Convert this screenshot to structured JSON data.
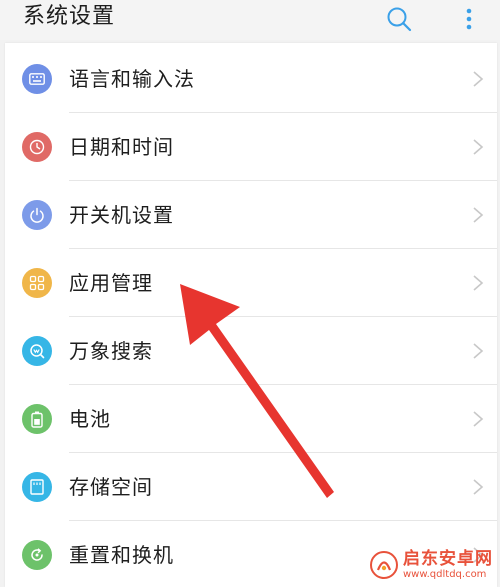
{
  "header": {
    "title": "系统设置",
    "search_icon": "search-icon",
    "more_icon": "more-vertical-icon"
  },
  "settings": {
    "items": [
      {
        "label": "语言和输入法",
        "icon": "keyboard-icon",
        "color": "#6f8fe6"
      },
      {
        "label": "日期和时间",
        "icon": "clock-icon",
        "color": "#e06a66"
      },
      {
        "label": "开关机设置",
        "icon": "power-icon",
        "color": "#7d9be9"
      },
      {
        "label": "应用管理",
        "icon": "apps-grid-icon",
        "color": "#f0b649"
      },
      {
        "label": "万象搜索",
        "icon": "search-circle-icon",
        "color": "#36b6e6"
      },
      {
        "label": "电池",
        "icon": "battery-icon",
        "color": "#6dc26a"
      },
      {
        "label": "存储空间",
        "icon": "storage-icon",
        "color": "#36b6e6"
      },
      {
        "label": "重置和换机",
        "icon": "reset-icon",
        "color": "#6dc26a"
      }
    ]
  },
  "annotation": {
    "arrow_color": "#e7352f"
  },
  "watermark": {
    "title": "启东安卓网",
    "url": "www.qdltdq.com"
  }
}
